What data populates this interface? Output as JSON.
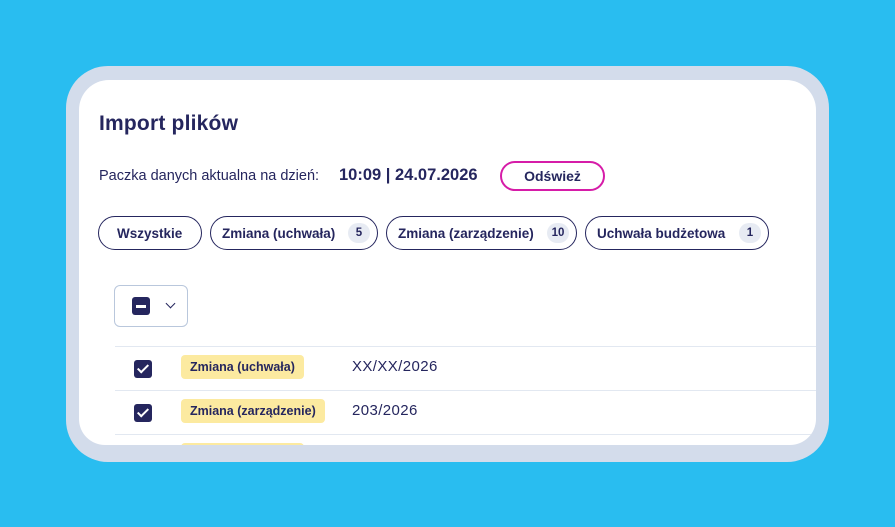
{
  "colors": {
    "background": "#29bdf0",
    "frame": "#d3dceb",
    "card": "#ffffff",
    "text": "#25265e",
    "accent_border": "#d61ca8",
    "tag_background": "#fceaa0",
    "count_badge_background": "#e7ebf3"
  },
  "page": {
    "title": "Import plików"
  },
  "status": {
    "label": "Paczka danych aktualna na dzień:",
    "value": "10:09 | 24.07.2026",
    "refresh_label": "Odśwież"
  },
  "filters": [
    {
      "label": "Wszystkie",
      "count": null
    },
    {
      "label": "Zmiana (uchwała)",
      "count": "5"
    },
    {
      "label": "Zmiana (zarządzenie)",
      "count": "10"
    },
    {
      "label": "Uchwała budżetowa",
      "count": "1"
    }
  ],
  "bulk_select": {
    "state": "indeterminate",
    "icons": [
      "minus-icon",
      "chevron-down-icon"
    ]
  },
  "rows": [
    {
      "checked": true,
      "type": "Zmiana (uchwała)",
      "number": "XX/XX/2026"
    },
    {
      "checked": true,
      "type": "Zmiana (zarządzenie)",
      "number": "203/2026"
    },
    {
      "checked": true,
      "type": "",
      "number": ""
    }
  ]
}
